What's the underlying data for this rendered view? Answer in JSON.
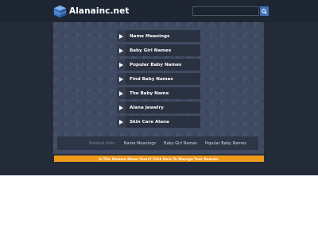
{
  "site": {
    "name": "Alanainc.net"
  },
  "search": {
    "placeholder": ""
  },
  "menu": {
    "items": [
      {
        "label": "Name Meanings"
      },
      {
        "label": "Baby Girl Names"
      },
      {
        "label": "Popular Baby Names"
      },
      {
        "label": "Find Baby Names"
      },
      {
        "label": "The Baby Name"
      },
      {
        "label": "Alana Jewelry"
      },
      {
        "label": "Skin Care Alana"
      }
    ]
  },
  "related": {
    "heading": "Related links:",
    "links": [
      {
        "label": "Name Meanings"
      },
      {
        "label": "Baby Girl Names"
      },
      {
        "label": "Popular Baby Names"
      }
    ]
  },
  "promo": {
    "text": "Is This Domain Name Yours? Click Here To Manage Your Domain."
  },
  "colors": {
    "header_bg": "#1f2633",
    "panel_bg": "#3f4b62",
    "menu_bg": "#2a3140",
    "accent": "#3f6fb4",
    "promo_bar": "#f09a1c"
  },
  "icons": {
    "logo": "stacked-cube-icon",
    "search": "search-icon",
    "menu_arrow": "play-arrow-icon"
  }
}
